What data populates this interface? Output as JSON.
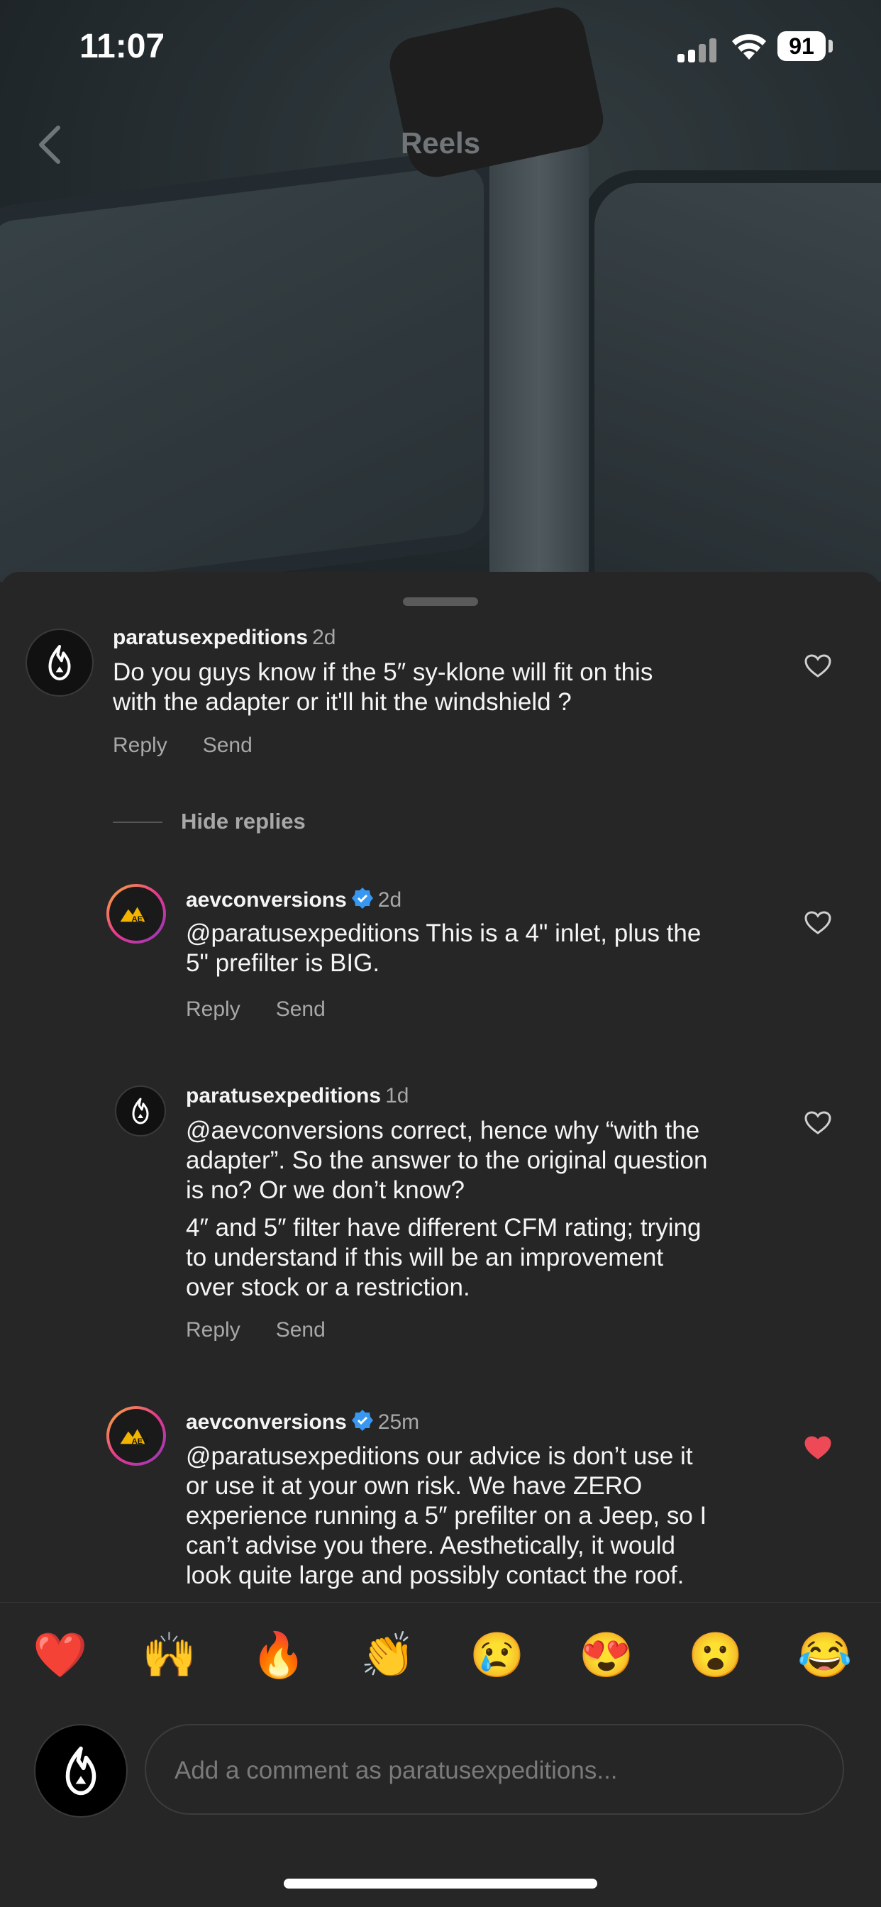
{
  "status_bar": {
    "time": "11:07",
    "battery": "91"
  },
  "nav": {
    "title": "Reels"
  },
  "comments": [
    {
      "username": "paratusexpeditions",
      "ago": "2d",
      "verified": false,
      "lines": [
        "Do you guys know if the 5″ sy-klone will fit on this",
        "with the adapter or it'll hit the windshield ?"
      ],
      "reply": "Reply",
      "send": "Send",
      "liked": false
    },
    {
      "username": "aevconversions",
      "ago": "2d",
      "verified": true,
      "lines": [
        "@paratusexpeditions This is a 4\" inlet, plus the",
        "5\" prefilter is BIG."
      ],
      "reply": "Reply",
      "send": "Send",
      "liked": false
    },
    {
      "username": "paratusexpeditions",
      "ago": "1d",
      "verified": false,
      "lines": [
        "@aevconversions correct, hence why “with the",
        "adapter”. So the answer to the original question",
        "is no? Or we don’t know?"
      ],
      "lines2": [
        "4″ and 5″ filter have different CFM rating; trying",
        "to understand if this will be an improvement",
        "over stock or a restriction."
      ],
      "reply": "Reply",
      "send": "Send",
      "liked": false
    },
    {
      "username": "aevconversions",
      "ago": "25m",
      "verified": true,
      "lines": [
        "@paratusexpeditions our advice is don’t use it",
        "or use it at your own risk. We have ZERO",
        "experience running a 5″ prefilter on a Jeep, so I",
        "can’t advise you there. Aesthetically, it would",
        "look quite large and possibly contact the roof."
      ],
      "liked": true
    }
  ],
  "hide_replies": "Hide replies",
  "emojis": [
    "❤️",
    "🙌",
    "🔥",
    "👏",
    "😢",
    "😍",
    "😮",
    "😂"
  ],
  "composer": {
    "placeholder": "Add a comment as paratusexpeditions..."
  },
  "colors": {
    "background": "#262626",
    "verified": "#3897f0",
    "liked_heart": "#ed4956",
    "secondary_text": "#a8a8a8"
  }
}
